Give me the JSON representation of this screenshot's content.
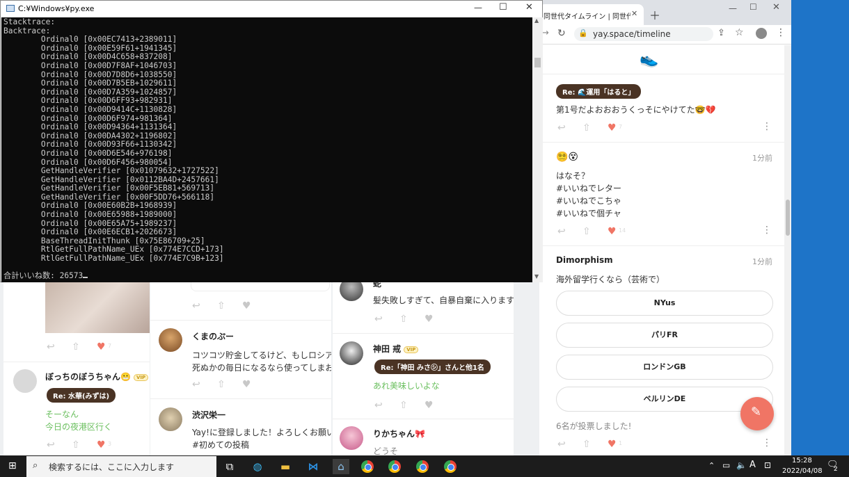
{
  "console": {
    "title": "C:¥Windows¥py.exe",
    "lines": [
      "Stacktrace:",
      "Backtrace:",
      "        Ordinal0 [0x00EC7413+2389011]",
      "        Ordinal0 [0x00E59F61+1941345]",
      "        Ordinal0 [0x00D4C658+837208]",
      "        Ordinal0 [0x00D7F8AF+1046703]",
      "        Ordinal0 [0x00D7D8D6+1038550]",
      "        Ordinal0 [0x00D7B5EB+1029611]",
      "        Ordinal0 [0x00D7A359+1024857]",
      "        Ordinal0 [0x00D6FF93+982931]",
      "        Ordinal0 [0x00D9414C+1130828]",
      "        Ordinal0 [0x00D6F974+981364]",
      "        Ordinal0 [0x00D94364+1131364]",
      "        Ordinal0 [0x00DA4302+1196802]",
      "        Ordinal0 [0x00D93F66+1130342]",
      "        Ordinal0 [0x00D6E546+976198]",
      "        Ordinal0 [0x00D6F456+980054]",
      "        GetHandleVerifier [0x01079632+1727522]",
      "        GetHandleVerifier [0x0112BA4D+2457661]",
      "        GetHandleVerifier [0x00F5EB81+569713]",
      "        GetHandleVerifier [0x00F5DD76+566118]",
      "        Ordinal0 [0x00E60B2B+1968939]",
      "        Ordinal0 [0x00E65988+1989000]",
      "        Ordinal0 [0x00E65A75+1989237]",
      "        Ordinal0 [0x00E6ECB1+2026673]",
      "        BaseThreadInitThunk [0x75E86709+25]",
      "        RtlGetFullPathName_UEx [0x774E7CCD+173]",
      "        RtlGetFullPathName_UEx [0x774E7C9B+123]",
      "",
      "合計いいね数: 26573"
    ]
  },
  "browser": {
    "tab_title": "同世代タイムライン | 同世代でつ",
    "url": "yay.space/timeline",
    "posts": [
      {
        "reply": "Re: 🌊運用「はると」",
        "text": "第1号だよおおおうくっそにやけてた🤓💔",
        "likes": "7"
      },
      {
        "name": "😵‍💫😵",
        "time": "1分前",
        "lines": [
          "はなそ？",
          "#いいねでレター",
          "#いいねでこちゃ",
          "#いいねで個チャ"
        ],
        "likes": "14"
      },
      {
        "name": "Dimorphism",
        "time": "1分前",
        "text": "海外留学行くなら（芸術で）",
        "options": [
          "NYus",
          "パリFR",
          "ロンドンGB",
          "ベルリンDE"
        ],
        "votes": "6名が投票しました!",
        "likes": "1"
      }
    ]
  },
  "back": {
    "col1": {
      "name": "ぼっちのぼうちゃん😬",
      "vip": "VIP",
      "reply": "Re: 水華(みずは)",
      "lines": [
        "そーなん",
        "今日の夜港区行く"
      ],
      "likes_top": "7",
      "likes": "3"
    },
    "col2": [
      {
        "name": "くまのぷー",
        "lines": [
          "コツコツ貯金してるけど、もしロシアがミサイ",
          "死ぬかの毎日になるなら使ってしまおうかって"
        ]
      },
      {
        "name": "渋沢栄一",
        "lines": [
          "Yay!に登録しました！よろしくお願いします！",
          "#初めての投稿"
        ]
      }
    ],
    "col3": [
      {
        "name": "蛇",
        "text": "髪失敗しすぎて、自暴自棄に入ります"
      },
      {
        "name": "神田 戒",
        "vip": "VIP",
        "reply": "Re:「神田 みさ㋛」さんと他1名",
        "text": "あれ美味しいよな"
      },
      {
        "name": "りかちゃん🎀",
        "text": "どうそ"
      }
    ]
  },
  "taskbar": {
    "search_placeholder": "検索するには、ここに入力します",
    "time": "15:28",
    "date": "2022/04/08",
    "notify": "2",
    "ime": "A"
  },
  "colors": {
    "accent": "#f07565",
    "reply_bg": "#4a3324",
    "green": "#6abf5e"
  }
}
